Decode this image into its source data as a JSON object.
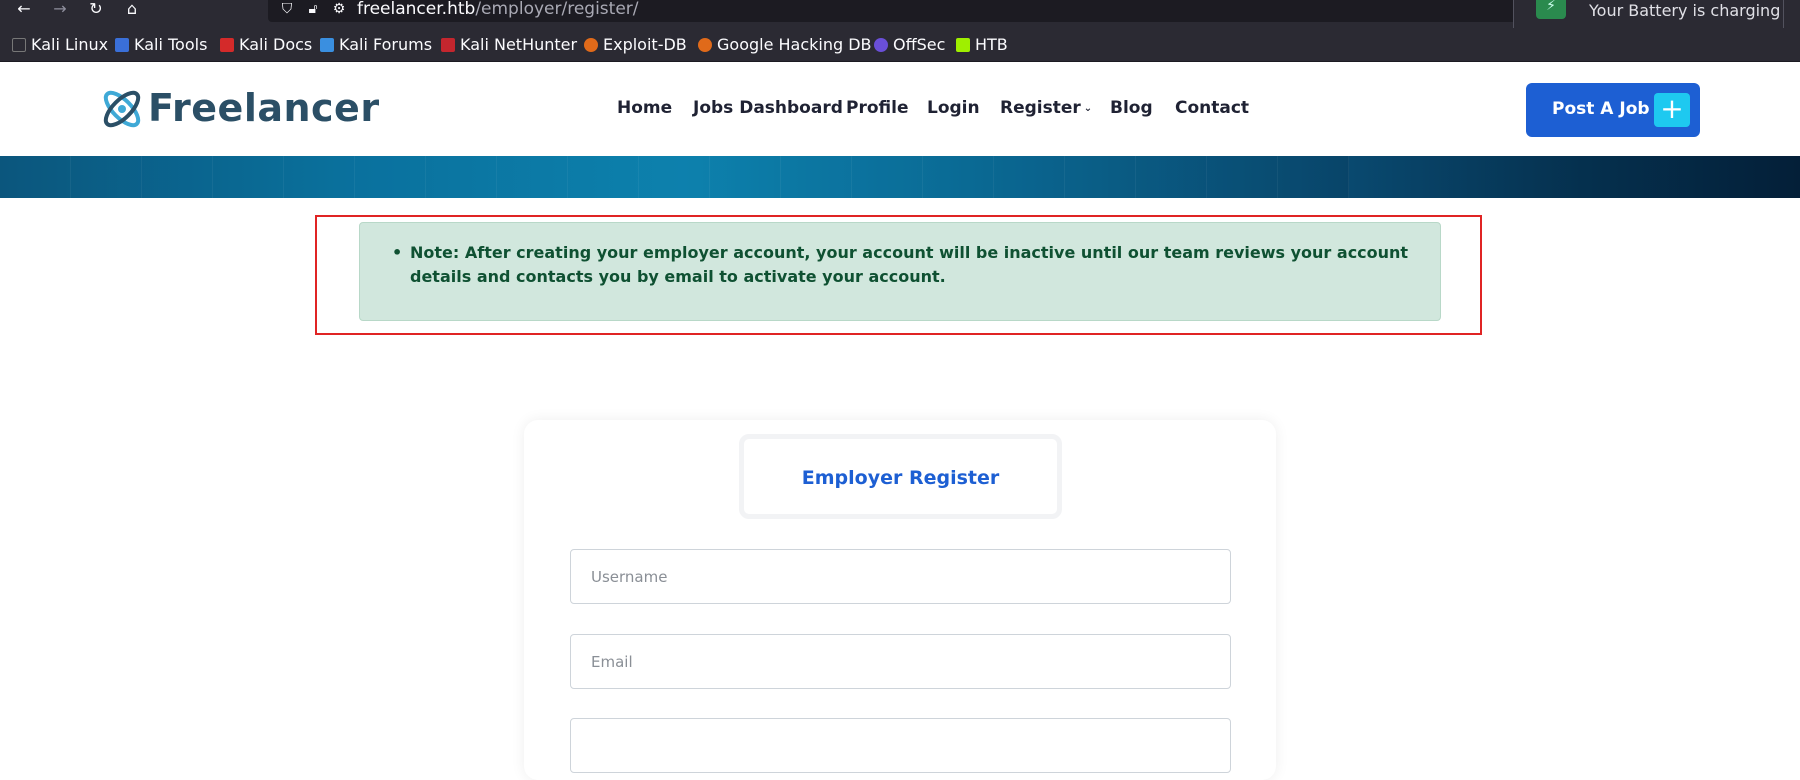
{
  "browser": {
    "url_host": "freelancer.htb",
    "url_path": "/employer/register/",
    "notification": "Your Battery is charging",
    "bookmarks": [
      "Kali Linux",
      "Kali Tools",
      "Kali Docs",
      "Kali Forums",
      "Kali NetHunter",
      "Exploit-DB",
      "Google Hacking DB",
      "OffSec",
      "HTB"
    ]
  },
  "header": {
    "logo_text": "Freelancer",
    "nav": [
      "Home",
      "Jobs Dashboard",
      "Profile",
      "Login",
      "Register",
      "Blog",
      "Contact"
    ],
    "post_job": "Post A Job",
    "post_job_icon": "+"
  },
  "note": {
    "text": "Note: After creating your employer account, your account will be inactive until our team reviews your account details and contacts you by email to activate your account."
  },
  "register": {
    "tab_title": "Employer Register",
    "username_placeholder": "Username",
    "email_placeholder": "Email",
    "username_value": "",
    "email_value": ""
  },
  "colors": {
    "brand_blue": "#1d5fd3",
    "accent_cyan": "#1ec9f0",
    "note_bg": "#d1e7dd",
    "note_text": "#0f5132",
    "highlight_border": "#e02424"
  }
}
